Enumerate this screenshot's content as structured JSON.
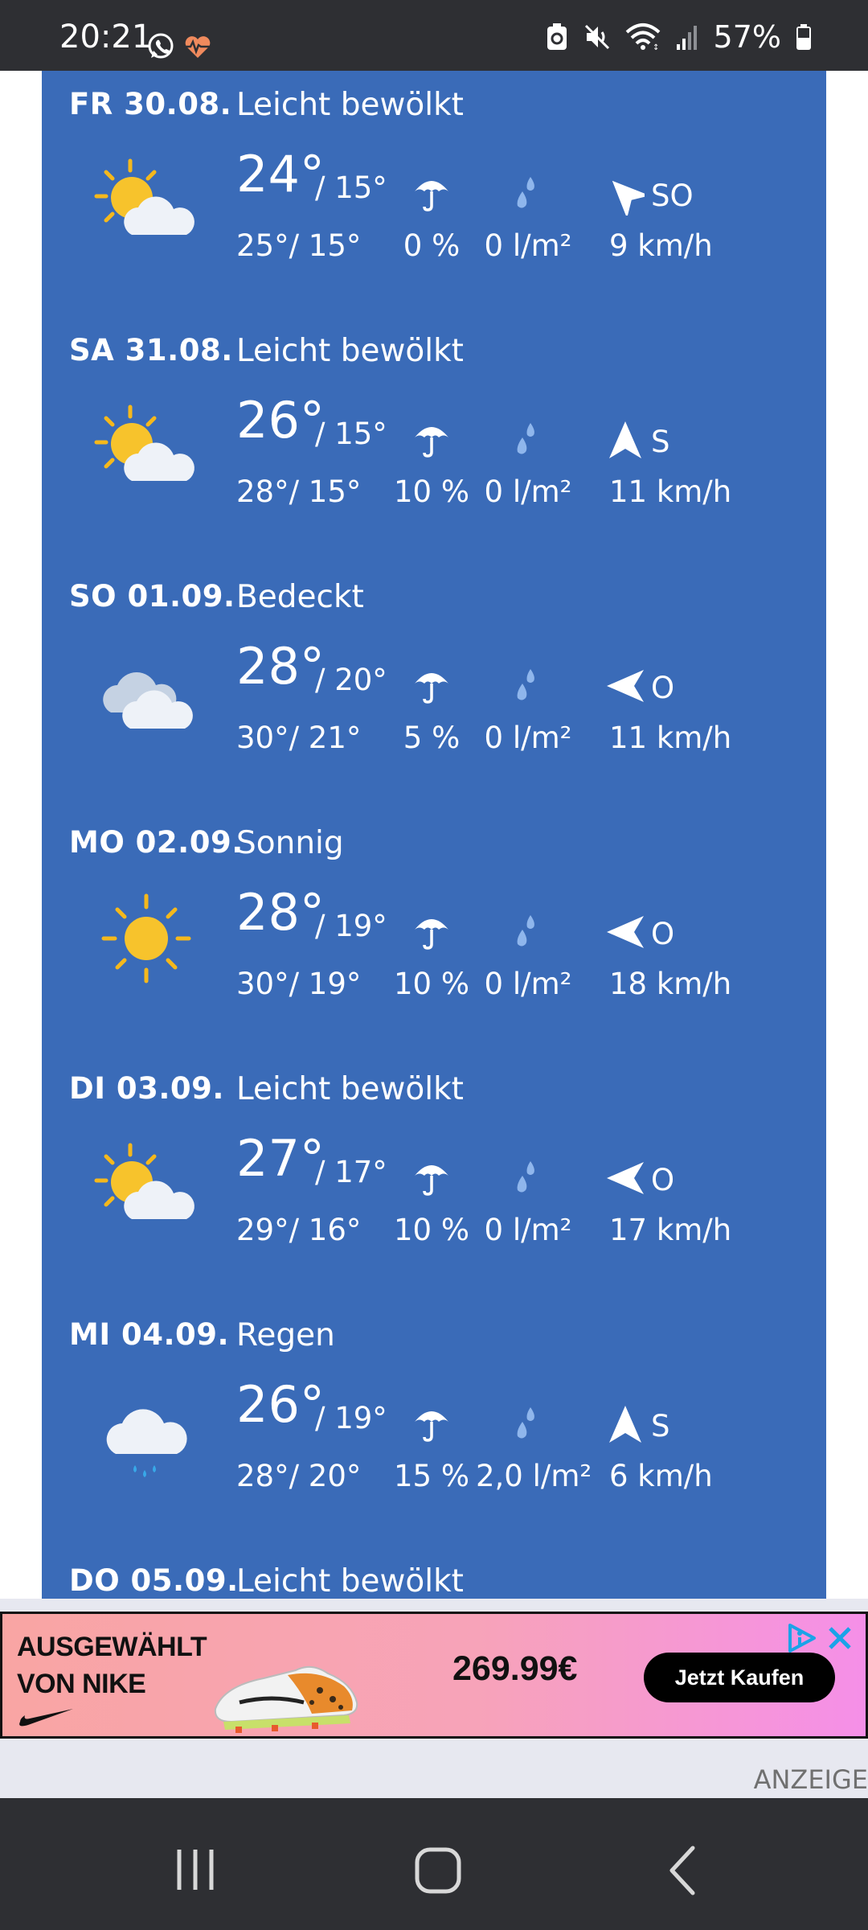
{
  "status_bar": {
    "time": "20:21",
    "battery": "57%",
    "left_icons": [
      "whatsapp-icon",
      "health-heart-icon"
    ],
    "right_icons": [
      "battery-saver-icon",
      "mute-icon",
      "wifi-icon",
      "signal-icon",
      "battery-icon"
    ]
  },
  "forecast": [
    {
      "date": "FR 30.08.",
      "condition": "Leicht bewölkt",
      "icon": "partly-cloudy-icon",
      "temp_max": "24°",
      "temp_min": "/ 15°",
      "feels": "25°/ 15°",
      "precip_prob": "0 %",
      "rain": "0 l/m²",
      "wind_dir": "SO",
      "wind_speed": "9 km/h",
      "wind_arrow_rotation_deg": -45
    },
    {
      "date": "SA 31.08.",
      "condition": "Leicht bewölkt",
      "icon": "partly-cloudy-icon",
      "temp_max": "26°",
      "temp_min": "/ 15°",
      "feels": "28°/ 15°",
      "precip_prob": "10 %",
      "rain": "0 l/m²",
      "wind_dir": "S",
      "wind_speed": "11 km/h",
      "wind_arrow_rotation_deg": 0
    },
    {
      "date": "SO 01.09.",
      "condition": "Bedeckt",
      "icon": "overcast-icon",
      "temp_max": "28°",
      "temp_min": "/ 20°",
      "feels": "30°/ 21°",
      "precip_prob": "5 %",
      "rain": "0 l/m²",
      "wind_dir": "O",
      "wind_speed": "11 km/h",
      "wind_arrow_rotation_deg": -90
    },
    {
      "date": "MO 02.09.",
      "condition": "Sonnig",
      "icon": "sunny-icon",
      "temp_max": "28°",
      "temp_min": "/ 19°",
      "feels": "30°/ 19°",
      "precip_prob": "10 %",
      "rain": "0 l/m²",
      "wind_dir": "O",
      "wind_speed": "18 km/h",
      "wind_arrow_rotation_deg": -90
    },
    {
      "date": "DI 03.09.",
      "condition": "Leicht bewölkt",
      "icon": "partly-cloudy-icon",
      "temp_max": "27°",
      "temp_min": "/ 17°",
      "feels": "29°/ 16°",
      "precip_prob": "10 %",
      "rain": "0 l/m²",
      "wind_dir": "O",
      "wind_speed": "17 km/h",
      "wind_arrow_rotation_deg": -90
    },
    {
      "date": "MI 04.09.",
      "condition": "Regen",
      "icon": "rain-icon",
      "temp_max": "26°",
      "temp_min": "/ 19°",
      "feels": "28°/ 20°",
      "precip_prob": "15 %",
      "rain": "2,0 l/m²",
      "wind_dir": "S",
      "wind_speed": "6 km/h",
      "wind_arrow_rotation_deg": 0
    },
    {
      "date": "DO 05.09.",
      "condition": "Leicht bewölkt",
      "icon": "partly-cloudy-icon",
      "temp_max": "",
      "temp_min": "",
      "feels": "",
      "precip_prob": "",
      "rain": "",
      "wind_dir": "",
      "wind_speed": "",
      "wind_arrow_rotation_deg": 0
    }
  ],
  "ad": {
    "brand_line1": "AUSGEWÄHLT",
    "brand_line2": "VON NIKE",
    "price": "269.99€",
    "cta": "Jetzt Kaufen",
    "label": "ANZEIGE"
  },
  "nav": {
    "icons": [
      "recent-apps-icon",
      "home-icon",
      "back-icon"
    ]
  }
}
